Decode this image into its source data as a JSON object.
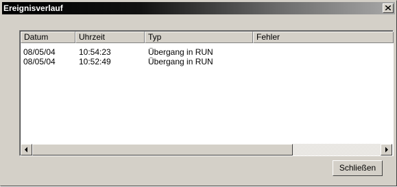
{
  "window": {
    "title": "Ereignisverlauf",
    "close_icon": "close-icon"
  },
  "list": {
    "columns": [
      "Datum",
      "Uhrzeit",
      "Typ",
      "Fehler"
    ],
    "rows": [
      {
        "datum": "08/05/04",
        "uhrzeit": "10:54:23",
        "typ": "Übergang in RUN",
        "fehler": ""
      },
      {
        "datum": "08/05/04",
        "uhrzeit": "10:52:49",
        "typ": "Übergang in RUN",
        "fehler": ""
      }
    ]
  },
  "buttons": {
    "close_label": "Schließen"
  },
  "colors": {
    "face": "#d4d0c8",
    "titlebar_start": "#000000",
    "titlebar_end": "#a8a8a8"
  }
}
